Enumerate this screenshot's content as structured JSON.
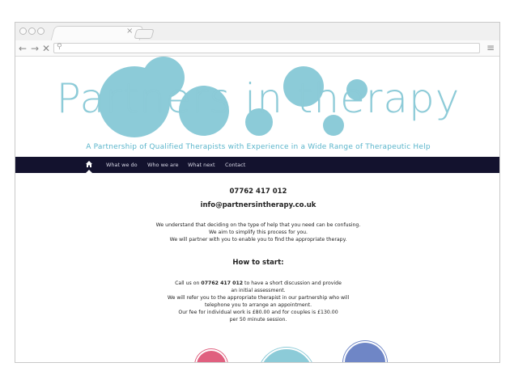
{
  "browser": {
    "tab_close": "×",
    "nav_back": "←",
    "nav_forward": "→",
    "nav_stop": "✕",
    "url_search_glyph": "⚲",
    "menu_glyph": "≡"
  },
  "site": {
    "logo_words": [
      "Partners ",
      "in ",
      "therapy"
    ],
    "tagline": "A Partnership of Qualified Therapists with Experience in a Wide Range of Therapeutic Help",
    "nav": [
      "What we do",
      "Who we are",
      "What next",
      "Contact"
    ],
    "phone": "07762 417 012",
    "email": "info@partnersintherapy.co.uk",
    "intro": [
      "We understand that deciding on the type of help that you need can be confusing.",
      "We aim to simplify this process for you.",
      "We will partner with you to enable you to find the appropriate therapy."
    ],
    "how_to_heading": "How to start:",
    "how_to": [
      "Call us on 07762 417 012 to have a short discussion and provide",
      "an initial assessment.",
      "We will refer you to the appropriate therapist in our partnership who will",
      "telephone you to arrange an appointment.",
      "Our fee for individual work is £80.00 and for couples is £130.00",
      "per 50 minute session."
    ]
  },
  "colors": {
    "bubble": "#8ccbd8",
    "nav_bg": "#13122e",
    "tagline": "#5bb5cb",
    "circle_pink": "#e0607f",
    "circle_teal": "#8ccbd8",
    "circle_blue": "#6f86c6"
  }
}
